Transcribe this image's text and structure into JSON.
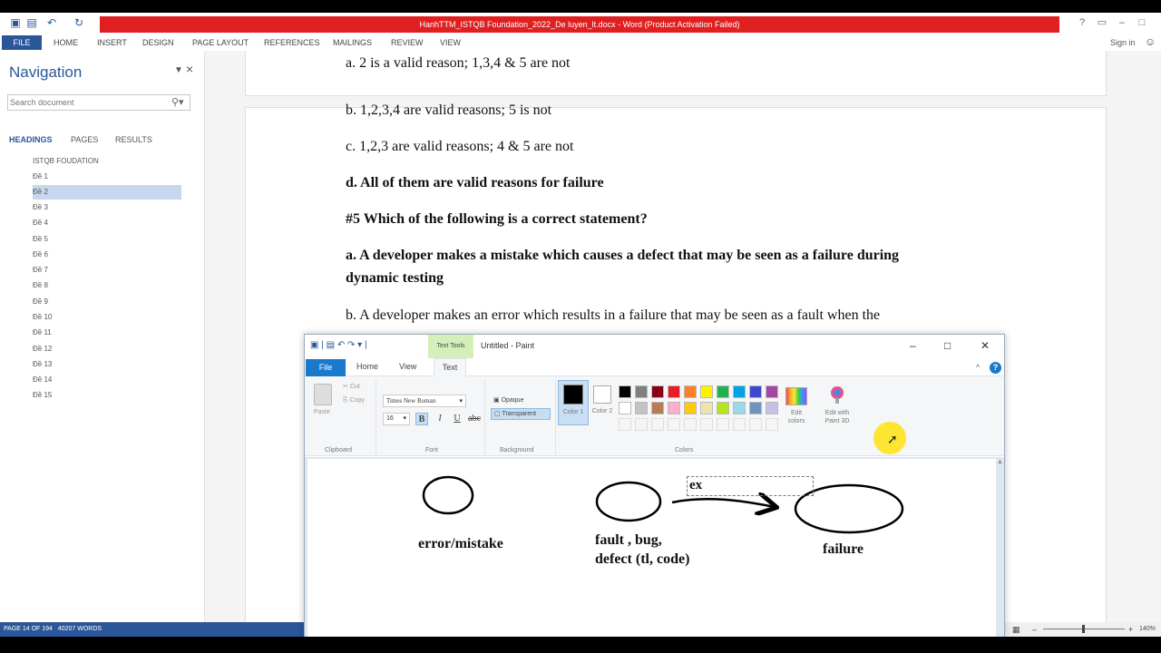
{
  "word": {
    "title": "HanhTTM_ISTQB Foundation_2022_De luyen_lt.docx - Word (Product Activation Failed)",
    "file_tab": "FILE",
    "tabs": [
      "HOME",
      "INSERT",
      "DESIGN",
      "PAGE LAYOUT",
      "REFERENCES",
      "MAILINGS",
      "REVIEW",
      "VIEW"
    ],
    "sign_in": "Sign in"
  },
  "navigation": {
    "title": "Navigation",
    "search_placeholder": "Search document",
    "tabs": [
      "HEADINGS",
      "PAGES",
      "RESULTS"
    ],
    "headings": [
      "ISTQB FOUDATION",
      "Đề 1",
      "Đề 2",
      "Đề 3",
      "Đề 4",
      "Đề 5",
      "Đề 6",
      "Đề 7",
      "Đề 8",
      "Đề 9",
      "Đề 10",
      "Đề 11",
      "Đề 12",
      "Đề 13",
      "Đề 14",
      "Đề 15"
    ],
    "selected_heading": "Đề 2"
  },
  "document": {
    "lines": [
      "a. 2 is a valid reason; 1,3,4 & 5 are not",
      "b. 1,2,3,4 are valid reasons; 5 is not",
      "c. 1,2,3 are valid reasons; 4 & 5 are not",
      "d. All of them are valid reasons for failure",
      "#5 Which of the following is a correct statement?",
      "a. A developer makes a mistake which causes a defect that may be seen as a failure during",
      "dynamic testing",
      "b. A developer makes an error which results in a failure that may be seen as a fault when the"
    ]
  },
  "status": {
    "page": "PAGE 14 OF 194",
    "words": "40207 WORDS",
    "zoom": "140%"
  },
  "paint": {
    "title": "Untitled - Paint",
    "context_tab": "Text Tools",
    "tabs": {
      "file": "File",
      "home": "Home",
      "view": "View",
      "text": "Text"
    },
    "clipboard": {
      "paste": "Paste",
      "cut": "Cut",
      "copy": "Copy",
      "group": "Clipboard"
    },
    "font": {
      "name": "Times New Roman",
      "size": "16",
      "group": "Font",
      "bold": "B",
      "italic": "I",
      "underline": "U"
    },
    "background": {
      "opaque": "Opaque",
      "transparent": "Transparent",
      "group": "Background"
    },
    "colors": {
      "color1": "Color 1",
      "color2": "Color 2",
      "edit_colors": "Edit colors",
      "paint3d": "Edit with Paint 3D",
      "group": "Colors",
      "palette_row1": [
        "#000000",
        "#7f7f7f",
        "#880015",
        "#ed1c24",
        "#ff7f27",
        "#fff200",
        "#22b14c",
        "#00a2e8",
        "#3f48cc",
        "#a349a4"
      ],
      "palette_row2": [
        "#ffffff",
        "#c3c3c3",
        "#b97a57",
        "#ffaec9",
        "#ffc90e",
        "#efe4b0",
        "#b5e61d",
        "#99d9ea",
        "#7092be",
        "#c8bfe7"
      ]
    },
    "canvas": {
      "label_error": "error/mistake",
      "label_fault_line1": "fault , bug,",
      "label_fault_line2": "defect (tl, code)",
      "label_failure": "failure",
      "text_box_value": "ex"
    }
  }
}
